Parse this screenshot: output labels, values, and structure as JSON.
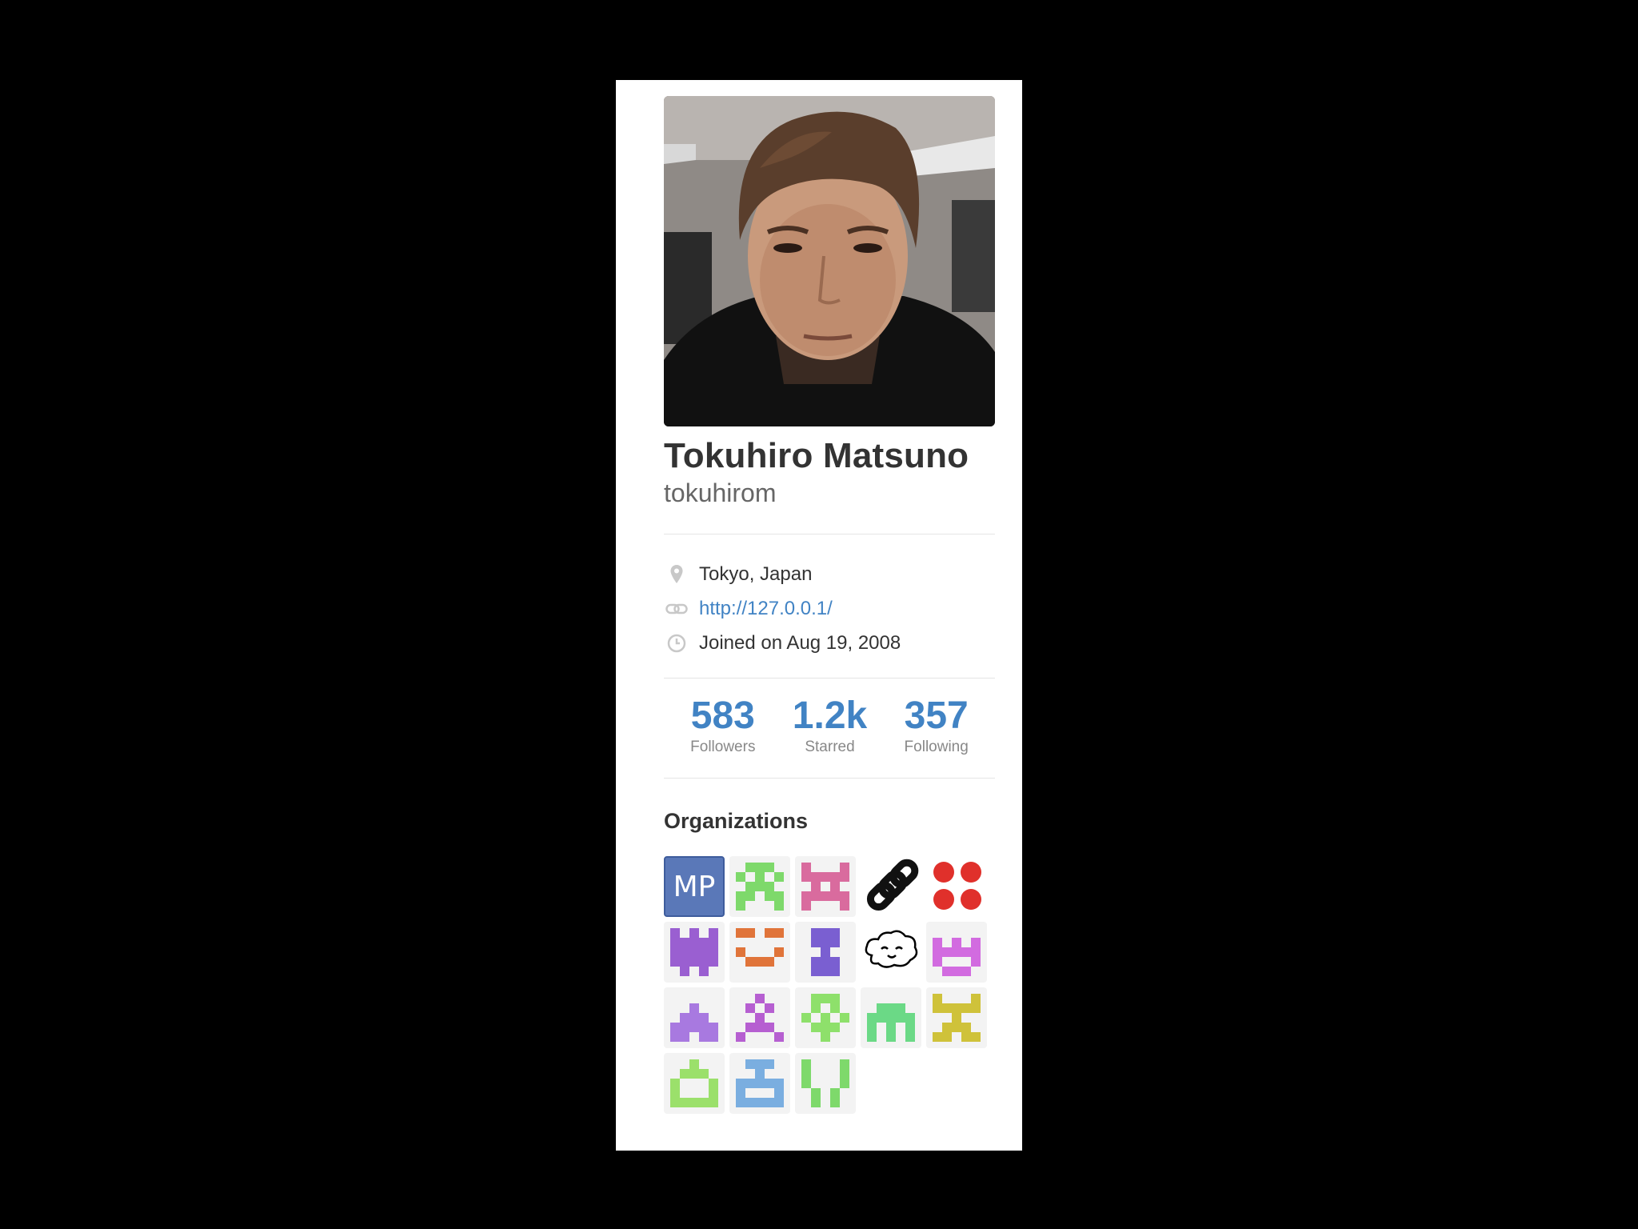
{
  "profile": {
    "full_name": "Tokuhiro Matsuno",
    "username": "tokuhirom"
  },
  "details": {
    "location": "Tokyo, Japan",
    "website": "http://127.0.0.1/",
    "joined": "Joined on Aug 19, 2008"
  },
  "stats": [
    {
      "value": "583",
      "label": "Followers"
    },
    {
      "value": "1.2k",
      "label": "Starred"
    },
    {
      "value": "357",
      "label": "Following"
    }
  ],
  "organizations": {
    "title": "Organizations",
    "items": [
      {
        "name": "org-mp",
        "text": "MP",
        "color": "#5a78b8"
      },
      {
        "name": "org-identicon-green",
        "color": "#7ed96b"
      },
      {
        "name": "org-identicon-pink",
        "color": "#d96b9e"
      },
      {
        "name": "org-chain",
        "color": "#111111"
      },
      {
        "name": "org-red-dots",
        "color": "#e0302b"
      },
      {
        "name": "org-identicon-purple",
        "color": "#9a5fd1"
      },
      {
        "name": "org-identicon-orange",
        "color": "#e0743a"
      },
      {
        "name": "org-identicon-violet",
        "color": "#7a5fd1"
      },
      {
        "name": "org-cloud-face",
        "color": "#000000"
      },
      {
        "name": "org-identicon-magenta",
        "color": "#d26be0"
      },
      {
        "name": "org-identicon-lavender",
        "color": "#a879e0"
      },
      {
        "name": "org-identicon-purple2",
        "color": "#b65fd1"
      },
      {
        "name": "org-identicon-lime",
        "color": "#8ee06b"
      },
      {
        "name": "org-identicon-mint",
        "color": "#6bd986"
      },
      {
        "name": "org-identicon-yellow",
        "color": "#cfc23a"
      },
      {
        "name": "org-identicon-lightgreen",
        "color": "#9be06b"
      },
      {
        "name": "org-identicon-blue",
        "color": "#7aaee0"
      },
      {
        "name": "org-identicon-green2",
        "color": "#7ed96b"
      }
    ]
  }
}
